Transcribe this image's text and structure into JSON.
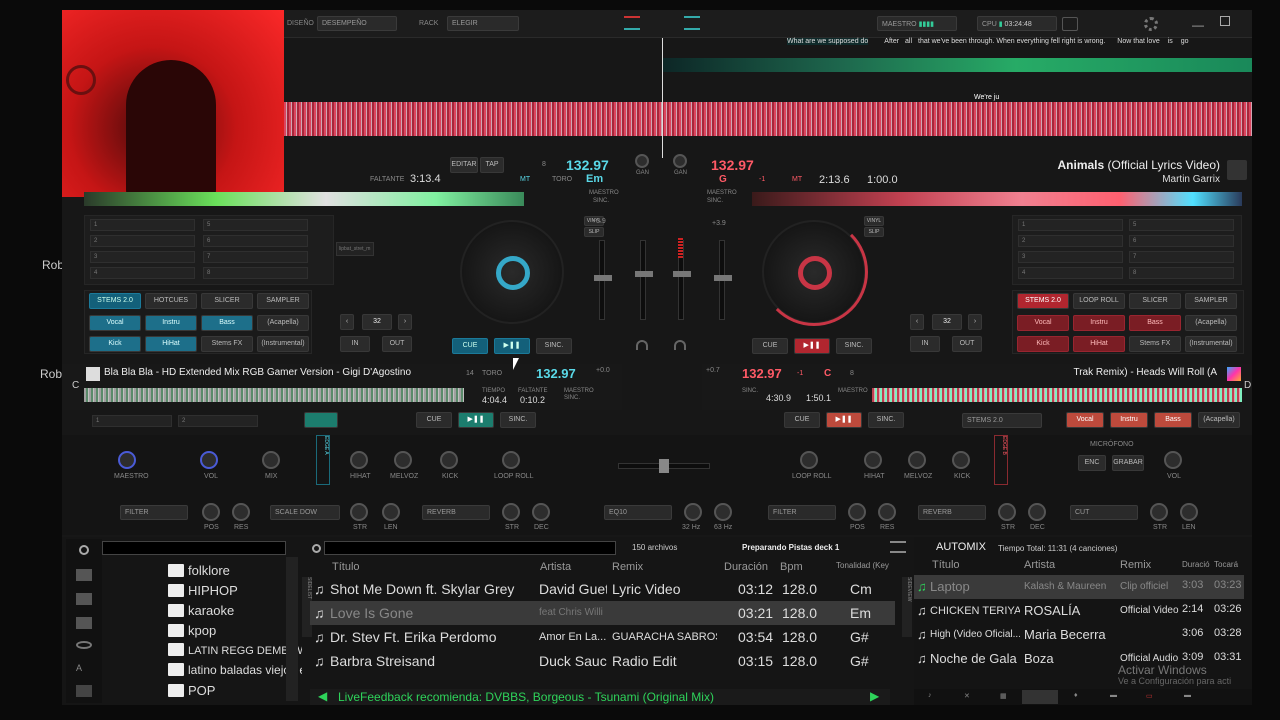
{
  "side_labels": {
    "rob1": "Rob",
    "rob2": "Rob"
  },
  "topbar": {
    "design_label": "DISEÑO",
    "design_value": "DESEMPEÑO",
    "rack_label": "RACK",
    "rack_value": "ELEGIR",
    "master_label": "MAESTRO",
    "cpu_label": "CPU",
    "clock": "03:24:48"
  },
  "lyrics": {
    "line1": "What are we supposed do",
    "w2": "After",
    "w3": "all",
    "w4": "that we've been through. When everything fell right is wrong.",
    "w5": "Now that love",
    "w6": "is",
    "w7": "go",
    "line2": "We're ju"
  },
  "deckA": {
    "edit": "EDITAR",
    "tap": "TAP",
    "key_shift": "8",
    "bpm": "132.97",
    "remaining_label": "FALTANTE",
    "remaining": "3:13.4",
    "mt": "MT",
    "toro": "TORO",
    "key": "Em",
    "maestro": "MAESTRO",
    "sinc": "SINC.",
    "vinyl": "VINYL",
    "slip": "SLIP",
    "pitch": "+3.9",
    "hotcues_label": "HOTCUES",
    "hotcues": [
      "1",
      "2",
      "3",
      "4",
      "5",
      "6",
      "7",
      "8"
    ],
    "loop_len": "32",
    "in": "IN",
    "out": "OUT",
    "pads": {
      "stems": "STEMS 2.0",
      "hotcues": "HOTCUES",
      "slicer": "SLICER",
      "sampler": "SAMPLER"
    },
    "stems": [
      "Vocal",
      "Instru",
      "Bass",
      "(Acapella)",
      "Kick",
      "HiHat",
      "Stems FX",
      "(Instrumental)"
    ],
    "cue": "CUE",
    "play": "▶❚❚",
    "sync": "SINC.",
    "sampler_slot": "lipbat_stret_m"
  },
  "deckB": {
    "bpm": "132.97",
    "key": "G",
    "shift": "-1",
    "mt": "MT",
    "elapsed": "2:13.6",
    "remaining": "1:00.0",
    "title": "Animals",
    "title_suffix": "(Official Lyrics Video)",
    "artist": "Martin Garrix",
    "maestro": "MAESTRO",
    "sinc": "SINC.",
    "pitch": "+3.9",
    "vinyl": "VINYL",
    "slip": "SLIP",
    "hotcues": [
      "1",
      "2",
      "3",
      "4",
      "5",
      "6",
      "7",
      "8"
    ],
    "loop_len": "32",
    "in": "IN",
    "out": "OUT",
    "pads": {
      "stems": "STEMS 2.0",
      "loop": "LOOP ROLL",
      "slicer": "SLICER",
      "sampler": "SAMPLER"
    },
    "stems": [
      "Vocal",
      "Instru",
      "Bass",
      "(Acapella)",
      "Kick",
      "HiHat",
      "Stems FX",
      "(Instrumental)"
    ],
    "cue": "CUE",
    "play": "▶❚❚",
    "sync": "SINC."
  },
  "deckC": {
    "letter": "C",
    "title": "Bla Bla Bla - HD Extended Mix  RGB Gamer Version - Gigi D'Agostino",
    "key_shift": "14",
    "toro": "TORO",
    "bpm": "132.97",
    "pitch": "+0.0",
    "time_label": "TIEMPO",
    "time": "4:04.4",
    "remaining_label": "FALTANTE",
    "remaining": "0:10.2",
    "maestro": "MAESTRO",
    "sinc": "SINC.",
    "cue": "CUE",
    "play": "▶❚❚",
    "sync": "SINC.",
    "slot1": "1",
    "slot2": "2"
  },
  "deckD": {
    "letter": "D",
    "bpm": "132.97",
    "shift": "-1",
    "key": "C",
    "keyshift": "8",
    "pitch": "+0.7",
    "title": "Trak Remix) - Heads Will Roll (A",
    "sinc": "SINC.",
    "time": "4:30.9",
    "remaining": "1:50.1",
    "maestro": "MAESTRO",
    "cue": "CUE",
    "play": "▶❚❚",
    "sync": "SINC.",
    "stems": "STEMS 2.0",
    "stem_btns": [
      "Vocal",
      "Instru",
      "Bass",
      "(Acapella)"
    ]
  },
  "mixer": {
    "gan": "GAN",
    "master": "MAESTRO",
    "vol": "VOL",
    "mix": "MIX",
    "hihat": "HIHAT",
    "melvoz": "MELVOZ",
    "kick": "KICK",
    "loop_roll": "LOOP ROLL",
    "mic": "MICRÓFONO",
    "enc": "ENC",
    "grabar": "GRABAR",
    "filter": "FILTER",
    "scale": "SCALE DOW",
    "reverb": "REVERB",
    "eq": "EQ10",
    "cut": "CUT",
    "pos": "POS",
    "res": "RES",
    "str": "STR",
    "len": "LEN",
    "dec": "DEC",
    "hz32": "32 Hz",
    "hz63": "63 Hz",
    "edge_a": "EDGE A",
    "edge_b": "EDGE B"
  },
  "browser": {
    "folders": [
      "folklore",
      "HIPHOP",
      "karaoke",
      "kpop",
      "LATIN REGG DEMBOW BR AF",
      "latino baladas viejos etc",
      "POP"
    ],
    "file_count": "150 archivos",
    "preparing": "Preparando Pistas deck 1",
    "headers": {
      "title": "Título",
      "artist": "Artista",
      "remix": "Remix",
      "duration": "Duración",
      "bpm": "Bpm",
      "key": "Tonalidad (Key"
    },
    "tracks": [
      {
        "title": "Shot Me Down ft. Skylar Grey",
        "artist": "David Guetta",
        "remix": "Lyric Video",
        "duration": "03:12",
        "bpm": "128.0",
        "key": "Cm"
      },
      {
        "title": "Love Is Gone",
        "artist": "feat Chris Willi",
        "remix": "",
        "duration": "03:21",
        "bpm": "128.0",
        "key": "Em"
      },
      {
        "title": "Dr. Stev Ft. Erika Perdomo",
        "artist": "Amor En La...",
        "remix": "GUARACHA SABROS...",
        "duration": "03:54",
        "bpm": "128.0",
        "key": "G#"
      },
      {
        "title": "Barbra Streisand",
        "artist": "Duck Sauce",
        "remix": "Radio Edit",
        "duration": "03:15",
        "bpm": "128.0",
        "key": "G#"
      }
    ],
    "livefeedback": "LiveFeedback recomienda: DVBBS, Borgeous - Tsunami (Original Mix)",
    "side_tabs": {
      "left": "SIDELIST",
      "right": "SIDEVIEW"
    }
  },
  "automix": {
    "title": "AUTOMIX",
    "total": "Tiempo Total: 11:31 (4 canciones)",
    "headers": {
      "title": "Título",
      "artist": "Artista",
      "remix": "Remix",
      "dur": "Duració",
      "played": "Tocará"
    },
    "tracks": [
      {
        "title": "Laptop",
        "artist": "Kalash & Maureen",
        "remix": "Clip officiel",
        "dur": "3:03",
        "played": "03:23"
      },
      {
        "title": "CHICKEN TERIYAKI",
        "artist": "ROSALÍA",
        "remix": "Official Video",
        "dur": "2:14",
        "played": "03:26"
      },
      {
        "title": "High (Video Oficial...",
        "artist": "Maria Becerra",
        "remix": "",
        "dur": "3:06",
        "played": "03:28"
      },
      {
        "title": "Noche de Gala",
        "artist": "Boza",
        "remix": "Official Audio",
        "dur": "3:09",
        "played": "03:31"
      }
    ],
    "watermark1": "Activar Windows",
    "watermark2": "Ve a Configuración para acti"
  }
}
